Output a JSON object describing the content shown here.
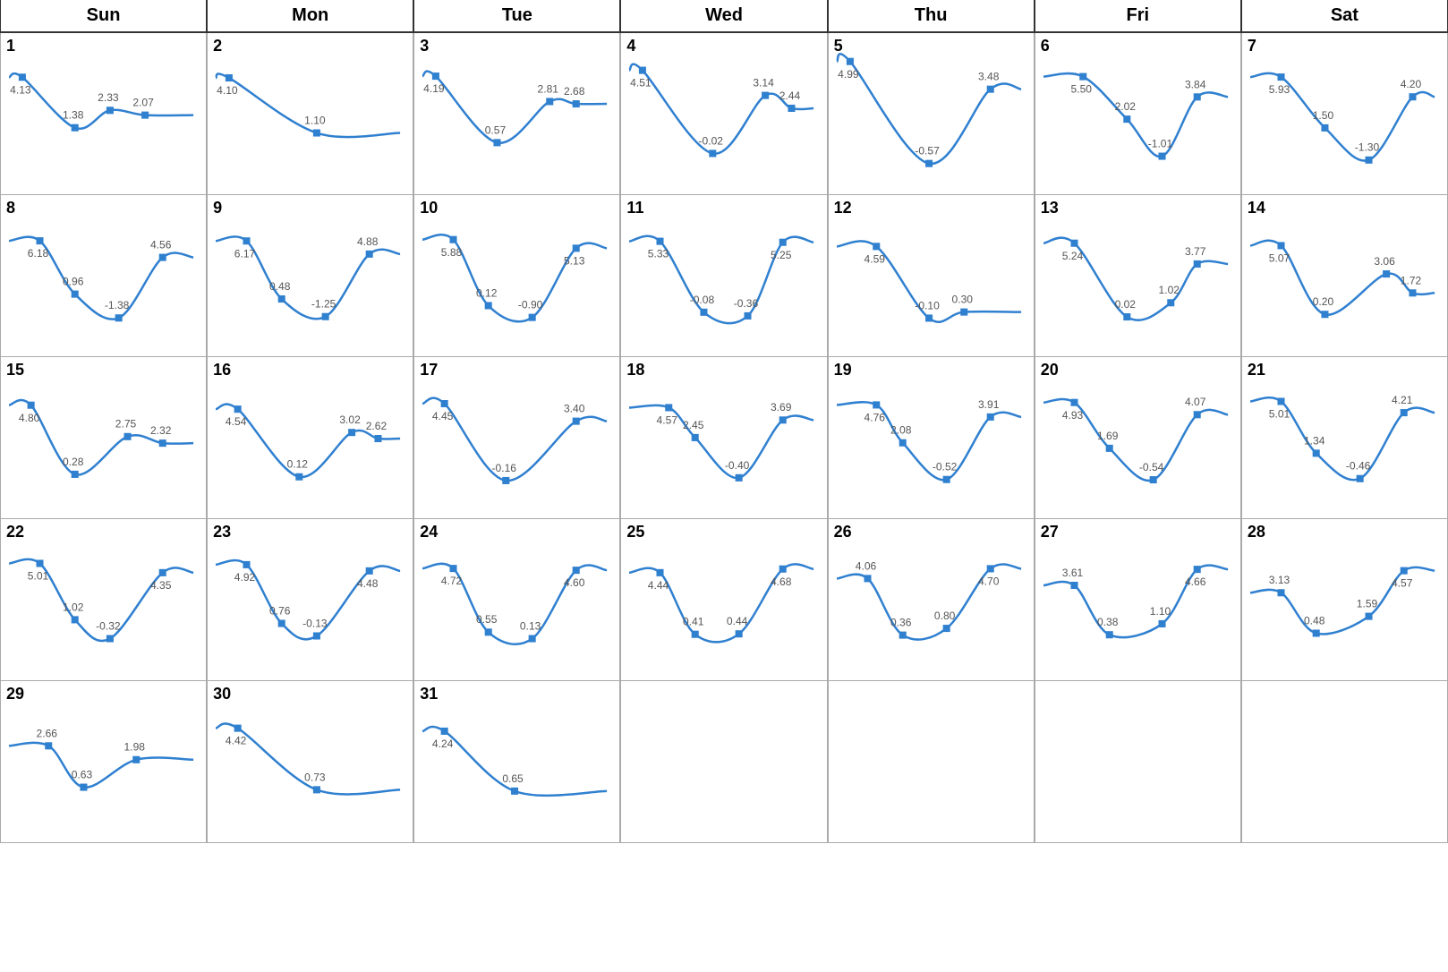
{
  "headers": [
    "Sun",
    "Mon",
    "Tue",
    "Wed",
    "Thu",
    "Fri",
    "Sat"
  ],
  "weeks": [
    [
      {
        "day": 1,
        "values": [
          4.13,
          1.38,
          2.33,
          2.07
        ],
        "positions": [
          0.05,
          0.35,
          0.55,
          0.75
        ],
        "min": -0.5,
        "max": 4.5
      },
      {
        "day": 2,
        "values": [
          4.1,
          1.1
        ],
        "positions": [
          0.05,
          0.55
        ],
        "min": -0.5,
        "max": 4.5
      },
      {
        "day": 3,
        "values": [
          4.19,
          0.57,
          2.81,
          2.68
        ],
        "positions": [
          0.05,
          0.4,
          0.7,
          0.85
        ],
        "min": -0.5,
        "max": 4.5
      },
      {
        "day": 4,
        "values": [
          4.51,
          -0.02,
          3.14,
          2.44
        ],
        "positions": [
          0.05,
          0.45,
          0.75,
          0.9
        ],
        "min": -0.5,
        "max": 4.5
      },
      {
        "day": 5,
        "values": [
          4.99,
          -0.57,
          3.48
        ],
        "positions": [
          0.05,
          0.5,
          0.85
        ],
        "min": -0.5,
        "max": 4.5
      },
      {
        "day": 6,
        "values": [
          5.5,
          2.02,
          -1.01,
          3.84
        ],
        "positions": [
          0.2,
          0.45,
          0.65,
          0.85
        ],
        "min": -1.5,
        "max": 6.0
      },
      {
        "day": 7,
        "values": [
          5.93,
          1.5,
          -1.3,
          4.2
        ],
        "positions": [
          0.15,
          0.4,
          0.65,
          0.9
        ],
        "min": -1.5,
        "max": 6.5
      }
    ],
    [
      {
        "day": 8,
        "values": [
          6.18,
          0.96,
          -1.38,
          4.56
        ],
        "positions": [
          0.15,
          0.35,
          0.6,
          0.85
        ],
        "min": -2.0,
        "max": 7.0
      },
      {
        "day": 9,
        "values": [
          6.17,
          0.48,
          -1.25,
          4.88
        ],
        "positions": [
          0.15,
          0.35,
          0.6,
          0.85
        ],
        "min": -2.0,
        "max": 7.0
      },
      {
        "day": 10,
        "values": [
          5.88,
          0.12,
          -0.9,
          5.13
        ],
        "positions": [
          0.15,
          0.35,
          0.6,
          0.85
        ],
        "min": -1.5,
        "max": 6.5
      },
      {
        "day": 11,
        "values": [
          5.33,
          -0.08,
          -0.36,
          5.25
        ],
        "positions": [
          0.15,
          0.4,
          0.65,
          0.85
        ],
        "min": -1.0,
        "max": 6.0
      },
      {
        "day": 12,
        "values": [
          4.59,
          -0.1,
          0.3
        ],
        "positions": [
          0.2,
          0.5,
          0.7
        ],
        "min": -0.5,
        "max": 5.5
      },
      {
        "day": 13,
        "values": [
          5.24,
          0.02,
          1.02,
          3.77
        ],
        "positions": [
          0.15,
          0.45,
          0.7,
          0.85
        ],
        "min": -0.5,
        "max": 6.0
      },
      {
        "day": 14,
        "values": [
          5.07,
          0.2,
          3.06,
          1.72
        ],
        "positions": [
          0.15,
          0.4,
          0.75,
          0.9
        ],
        "min": -0.5,
        "max": 6.0
      }
    ],
    [
      {
        "day": 15,
        "values": [
          4.8,
          0.28,
          2.75,
          2.32
        ],
        "positions": [
          0.1,
          0.35,
          0.65,
          0.85
        ],
        "min": -0.5,
        "max": 5.5
      },
      {
        "day": 16,
        "values": [
          4.54,
          0.12,
          3.02,
          2.62
        ],
        "positions": [
          0.1,
          0.45,
          0.75,
          0.9
        ],
        "min": -0.5,
        "max": 5.5
      },
      {
        "day": 17,
        "values": [
          4.45,
          -0.16,
          3.4
        ],
        "positions": [
          0.1,
          0.45,
          0.85
        ],
        "min": -0.5,
        "max": 5.0
      },
      {
        "day": 18,
        "values": [
          4.57,
          2.45,
          -0.4,
          3.69
        ],
        "positions": [
          0.2,
          0.35,
          0.6,
          0.85
        ],
        "min": -1.0,
        "max": 5.5
      },
      {
        "day": 19,
        "values": [
          4.76,
          2.08,
          -0.52,
          3.91
        ],
        "positions": [
          0.2,
          0.35,
          0.6,
          0.85
        ],
        "min": -1.0,
        "max": 5.5
      },
      {
        "day": 20,
        "values": [
          4.93,
          1.69,
          -0.54,
          4.07
        ],
        "positions": [
          0.15,
          0.35,
          0.6,
          0.85
        ],
        "min": -1.0,
        "max": 5.5
      },
      {
        "day": 21,
        "values": [
          5.01,
          1.34,
          -0.46,
          4.21
        ],
        "positions": [
          0.15,
          0.35,
          0.6,
          0.85
        ],
        "min": -1.0,
        "max": 5.5
      }
    ],
    [
      {
        "day": 22,
        "values": [
          5.01,
          1.02,
          -0.32,
          4.35
        ],
        "positions": [
          0.15,
          0.35,
          0.55,
          0.85
        ],
        "min": -1.0,
        "max": 5.5
      },
      {
        "day": 23,
        "values": [
          4.92,
          0.76,
          -0.13,
          4.48
        ],
        "positions": [
          0.15,
          0.35,
          0.55,
          0.85
        ],
        "min": -1.0,
        "max": 5.5
      },
      {
        "day": 24,
        "values": [
          4.72,
          0.55,
          0.13,
          4.6
        ],
        "positions": [
          0.15,
          0.35,
          0.6,
          0.85
        ],
        "min": -0.5,
        "max": 5.5
      },
      {
        "day": 25,
        "values": [
          4.44,
          0.41,
          0.44,
          4.68
        ],
        "positions": [
          0.15,
          0.35,
          0.6,
          0.85
        ],
        "min": -0.5,
        "max": 5.5
      },
      {
        "day": 26,
        "values": [
          4.06,
          0.36,
          0.8,
          4.7
        ],
        "positions": [
          0.15,
          0.35,
          0.6,
          0.85
        ],
        "min": -0.5,
        "max": 5.5
      },
      {
        "day": 27,
        "values": [
          3.61,
          0.38,
          1.1,
          4.66
        ],
        "positions": [
          0.15,
          0.35,
          0.65,
          0.85
        ],
        "min": -0.5,
        "max": 5.5
      },
      {
        "day": 28,
        "values": [
          3.13,
          0.48,
          1.59,
          4.57
        ],
        "positions": [
          0.15,
          0.35,
          0.65,
          0.85
        ],
        "min": -0.5,
        "max": 5.5
      }
    ],
    [
      {
        "day": 29,
        "values": [
          2.66,
          0.63,
          1.98
        ],
        "positions": [
          0.2,
          0.4,
          0.7
        ],
        "min": -0.5,
        "max": 4.0
      },
      {
        "day": 30,
        "values": [
          4.42,
          0.73
        ],
        "positions": [
          0.1,
          0.55
        ],
        "min": -0.5,
        "max": 5.0
      },
      {
        "day": 31,
        "values": [
          4.24,
          0.65
        ],
        "positions": [
          0.1,
          0.5
        ],
        "min": -0.5,
        "max": 5.0
      },
      null,
      null,
      null,
      null
    ]
  ]
}
